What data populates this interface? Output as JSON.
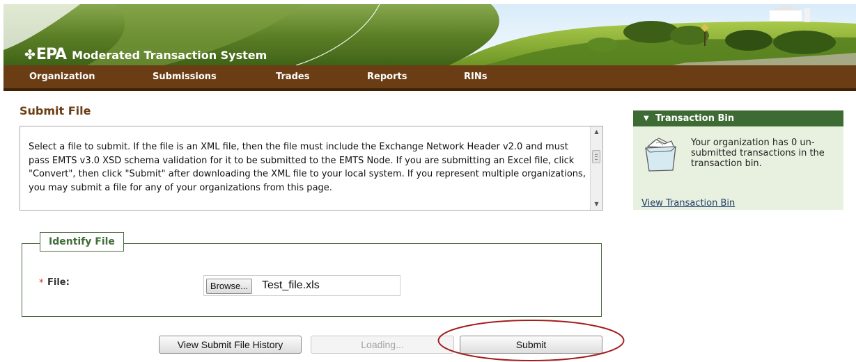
{
  "header": {
    "logo_mark": "EPA",
    "logo_symbol": "✤",
    "app_title": "Moderated Transaction System"
  },
  "nav": {
    "items": [
      {
        "label": "Organization"
      },
      {
        "label": "Submissions"
      },
      {
        "label": "Trades"
      },
      {
        "label": "Reports"
      },
      {
        "label": "RINs"
      }
    ]
  },
  "main": {
    "title": "Submit File",
    "description": "Select a file to submit. If the file is an XML file, then the file must include the Exchange Network Header v2.0 and must pass EMTS v3.0 XSD schema validation for it to be submitted to the EMTS Node. If you are submitting an Excel file, click \"Convert\", then click \"Submit\" after downloading the XML file to your local system. If you represent multiple organizations, you may submit a file for any of your organizations from this page.",
    "fieldset": {
      "legend": "Identify File",
      "required_marker": "*",
      "file_label": "File:",
      "browse_label": "Browse...",
      "file_value": "Test_file.xls"
    },
    "buttons": {
      "history": "View Submit File History",
      "loading": "Loading...",
      "submit": "Submit"
    }
  },
  "sidebar": {
    "bin": {
      "caret": "▼",
      "title": "Transaction Bin",
      "message": "Your organization has 0 un-submitted transactions in the transaction bin.",
      "link": "View Transaction Bin"
    }
  },
  "colors": {
    "nav_bg": "#6b3d14",
    "banner_green": "#5a7d2a",
    "panel_header": "#3d6b34",
    "panel_bg": "#e8f1df",
    "title_brown": "#6b3d14",
    "highlight_circle": "#a51c1c"
  }
}
